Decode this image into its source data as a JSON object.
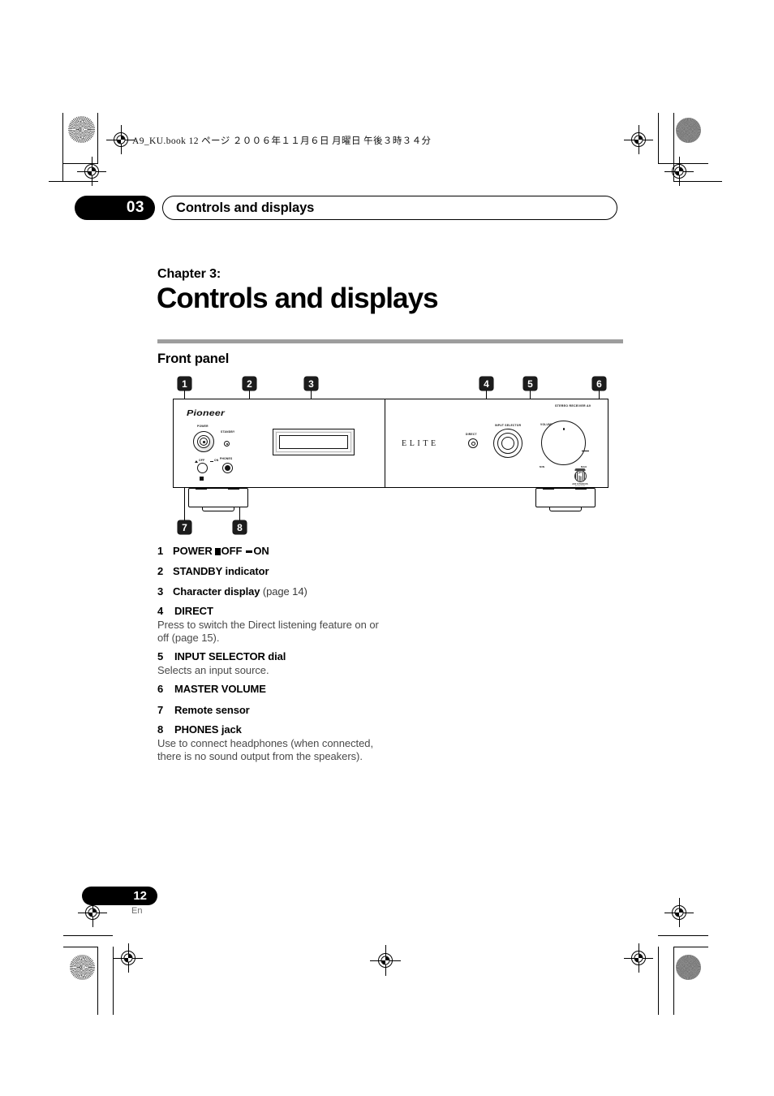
{
  "print_marks": {
    "file_header": "A9_KU.book   12 ページ   ２００６年１１月６日   月曜日   午後３時３４分"
  },
  "running_head": {
    "chapter_number": "03",
    "chapter_title": "Controls and displays"
  },
  "chapter": {
    "kicker": "Chapter 3:",
    "title": "Controls and displays"
  },
  "section": {
    "title": "Front panel"
  },
  "diagram": {
    "name": "front-panel-illustration",
    "brand": "Pioneer",
    "sub_brand": "ELITE",
    "model_text": "STEREO RECEIVER A9",
    "panel_labels": {
      "power": "POWER",
      "standby": "STANDBY",
      "off": "OFF",
      "on": "ON",
      "phones": "PHONES",
      "direct": "DIRECT",
      "input_selector": "INPUT SELECTOR",
      "volume": "VOLUME",
      "min": "MIN",
      "max": "MAX"
    },
    "air_studios": {
      "line1": "AIR STUDIOS",
      "line2": "MONITOR"
    },
    "callouts": [
      "1",
      "2",
      "3",
      "4",
      "5",
      "6",
      "7",
      "8"
    ]
  },
  "items": [
    {
      "num": "1",
      "term": "POWER",
      "glyph_off_label": "OFF",
      "glyph_on_label": "ON",
      "desc": ""
    },
    {
      "num": "2",
      "term": "STANDBY indicator",
      "desc": ""
    },
    {
      "num": "3",
      "term": "Character display",
      "page_ref": "(page 14)",
      "desc": ""
    },
    {
      "num": "4",
      "term": "DIRECT",
      "desc": "Press to switch the Direct listening feature on or off (page 15)."
    },
    {
      "num": "5",
      "term": "INPUT SELECTOR dial",
      "desc": "Selects an input source."
    },
    {
      "num": "6",
      "term": "MASTER VOLUME",
      "desc": ""
    },
    {
      "num": "7",
      "term": "Remote sensor",
      "desc": ""
    },
    {
      "num": "8",
      "term": "PHONES jack",
      "desc": "Use to connect headphones (when connected, there is no sound output from the speakers)."
    }
  ],
  "footer": {
    "page_number": "12",
    "language": "En"
  }
}
